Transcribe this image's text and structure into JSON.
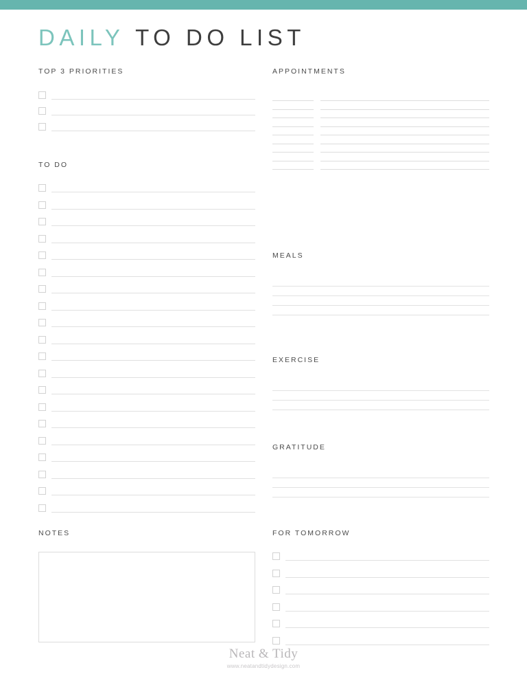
{
  "theme": {
    "accent_color": "#66b5ae",
    "title_accent_color": "#7cc4bc",
    "title_main_color": "#3d3d3d",
    "heading_color": "#4a4a4a",
    "rule_color": "#e0e0e0",
    "checkbox_border_color": "#d2d2d2",
    "footer_color": "#b9b7b9"
  },
  "title": {
    "accent_word": "DAILY",
    "main_words": "TO DO LIST"
  },
  "left_column": {
    "priorities": {
      "heading": "TOP 3 PRIORITIES",
      "row_count": 3
    },
    "todo": {
      "heading": "TO DO",
      "row_count": 20
    },
    "notes": {
      "heading": "NOTES",
      "value": "",
      "placeholder": ""
    }
  },
  "right_column": {
    "appointments": {
      "heading": "APPOINTMENTS",
      "row_count": 9
    },
    "meals": {
      "heading": "MEALS",
      "row_count": 4
    },
    "exercise": {
      "heading": "EXERCISE",
      "row_count": 3
    },
    "gratitude": {
      "heading": "GRATITUDE",
      "row_count": 3
    },
    "for_tomorrow": {
      "heading": "FOR TOMORROW",
      "row_count": 6
    }
  },
  "footer": {
    "brand": "Neat & Tidy",
    "url": "www.neatandtidydesign.com"
  }
}
